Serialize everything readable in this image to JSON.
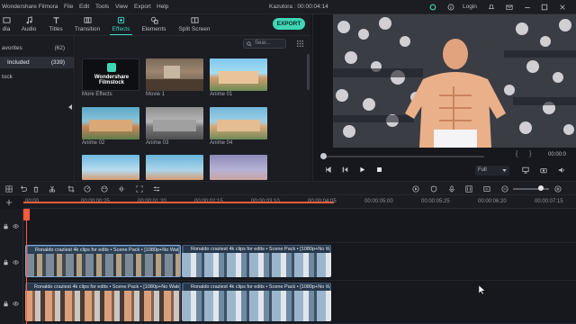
{
  "titlebar": {
    "app_title": "Wondershare Filmora",
    "menu": [
      "File",
      "Edit",
      "Tools",
      "View",
      "Export",
      "Help"
    ],
    "project": "Kazutora : 00:00:04:14",
    "login": "Login"
  },
  "toolbar": {
    "tabs": [
      {
        "label": "dia",
        "icon": "media-icon"
      },
      {
        "label": "Audio",
        "icon": "music-note-icon"
      },
      {
        "label": "Titles",
        "icon": "text-t-icon"
      },
      {
        "label": "Transition",
        "icon": "transition-icon"
      },
      {
        "label": "Effects",
        "icon": "effects-icon",
        "active": true
      },
      {
        "label": "Elements",
        "icon": "elements-icon"
      },
      {
        "label": "Split Screen",
        "icon": "split-screen-icon"
      }
    ],
    "export_label": "EXPORT",
    "accent_color": "#3fd6b4"
  },
  "sidebar": {
    "items": [
      {
        "label": "avorites",
        "count": "(62)"
      },
      {
        "label": "Included",
        "count": "(339)",
        "selected": true
      },
      {
        "label": "tock",
        "count": ""
      }
    ]
  },
  "effects": {
    "search_placeholder": "Sear...",
    "items": [
      {
        "label": "More Effects",
        "brand": "Wondershare Filmstock"
      },
      {
        "label": "Movie 1"
      },
      {
        "label": "Anime 01"
      },
      {
        "label": "Anime 02"
      },
      {
        "label": "Anime 03"
      },
      {
        "label": "Anime 04"
      },
      {
        "label": ""
      },
      {
        "label": ""
      },
      {
        "label": ""
      }
    ]
  },
  "preview": {
    "timecode": "00:00:0",
    "quality": "Full"
  },
  "timeline": {
    "ruler_labels": [
      "00:00",
      "00:00:00:25",
      "00:00:01:20",
      "00:00:02:15",
      "00:00:03:10",
      "00:00:04:05",
      "00:00:05:00",
      "00:00:05:25",
      "00:00:06:20",
      "00:00:07:15"
    ],
    "clips": [
      {
        "title": "Ronaldo craziest 4k clips for edits • Scene Pack • [1080p+No Watermark]"
      },
      {
        "title": "Ronaldo craziest 4k clips for edits • Scene Pack • [1080p+No Watermark]"
      },
      {
        "title": "Ronaldo craziest 4k clips for edits • Scene Pack • [1080p+No Watermark]"
      },
      {
        "title": "Ronaldo craziest 4k clips for edits • Scene Pack • [1080p+No Watermark]"
      }
    ],
    "playhead_color": "#ff5b3a"
  }
}
